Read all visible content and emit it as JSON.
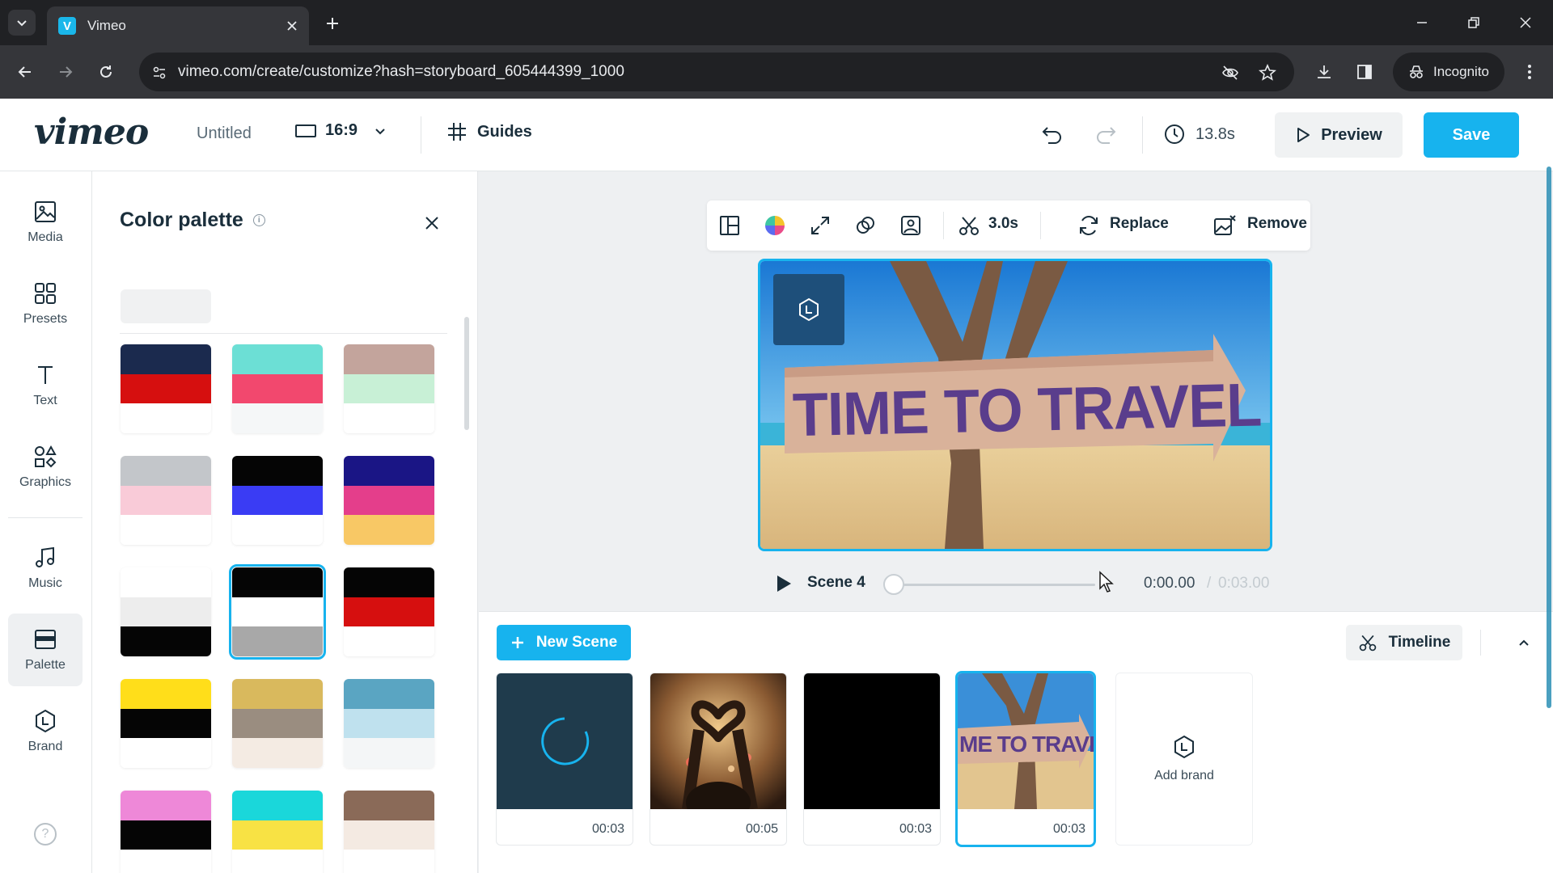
{
  "browser": {
    "tab_title": "Vimeo",
    "tab_favicon_letter": "V",
    "url": "vimeo.com/create/customize?hash=storyboard_605444399_1000",
    "incognito_label": "Incognito"
  },
  "header": {
    "logo": "vimeo",
    "project_title": "Untitled",
    "aspect_ratio": "16:9",
    "guides_label": "Guides",
    "duration": "13.8s",
    "preview_label": "Preview",
    "save_label": "Save"
  },
  "rail": {
    "items": [
      {
        "label": "Media",
        "icon": "image-icon"
      },
      {
        "label": "Presets",
        "icon": "grid-icon"
      },
      {
        "label": "Text",
        "icon": "text-icon"
      },
      {
        "label": "Graphics",
        "icon": "shapes-icon"
      },
      {
        "label": "Music",
        "icon": "music-note-icon"
      },
      {
        "label": "Palette",
        "icon": "palette-icon"
      },
      {
        "label": "Brand",
        "icon": "brand-hexagon-icon"
      }
    ],
    "help": "?"
  },
  "palette_panel": {
    "title": "Color palette",
    "info": "i",
    "swatches": [
      {
        "colors": [
          "#1b2a4e",
          "#d60f0f",
          "#ffffff"
        ]
      },
      {
        "colors": [
          "#6cdfd5",
          "#f2486e",
          "#f5f7f8"
        ]
      },
      {
        "colors": [
          "#c3a49c",
          "#c8f0d6",
          "#ffffff"
        ]
      },
      {
        "colors": [
          "#c3c6ca",
          "#f9cbd8",
          "#ffffff"
        ]
      },
      {
        "colors": [
          "#050505",
          "#3a3cf4",
          "#ffffff"
        ]
      },
      {
        "colors": [
          "#1a1585",
          "#e43e8b",
          "#f8c865"
        ]
      },
      {
        "colors": [
          "#ffffff",
          "#ededed",
          "#050505"
        ]
      },
      {
        "colors": [
          "#050505",
          "#ffffff",
          "#a8a8a8"
        ],
        "selected": true
      },
      {
        "colors": [
          "#050505",
          "#d60f0f",
          "#ffffff"
        ]
      },
      {
        "colors": [
          "#ffde1a",
          "#050505",
          "#ffffff"
        ]
      },
      {
        "colors": [
          "#d9b95d",
          "#9a8d80",
          "#f4ebe3"
        ]
      },
      {
        "colors": [
          "#5aa5c2",
          "#bfe1ee",
          "#f4f6f7"
        ]
      },
      {
        "colors": [
          "#ee88d8",
          "#050505",
          "#ffffff"
        ]
      },
      {
        "colors": [
          "#1ad7da",
          "#f8e244",
          "#ffffff"
        ]
      },
      {
        "colors": [
          "#8a6a58",
          "#f4eae2",
          "#ffffff"
        ]
      }
    ]
  },
  "canvas_toolbar": {
    "duration": "3.0s",
    "replace_label": "Replace",
    "remove_label": "Remove"
  },
  "stage": {
    "sign_text": "TIME TO TRAVEL"
  },
  "player": {
    "scene_label": "Scene 4",
    "current_time": "0:00.00",
    "separator": "/",
    "total_time": "0:03.00"
  },
  "scenes": {
    "new_scene_label": "New Scene",
    "timeline_label": "Timeline",
    "add_brand_label": "Add brand",
    "cards": [
      {
        "duration": "00:03",
        "kind": "loading"
      },
      {
        "duration": "00:05",
        "kind": "concert"
      },
      {
        "duration": "00:03",
        "kind": "black"
      },
      {
        "duration": "00:03",
        "kind": "travel",
        "thumb_text": "ME TO TRAVEL",
        "selected": true
      }
    ]
  },
  "colors": {
    "accent": "#17b3ee",
    "text": "#1a2e3b"
  }
}
